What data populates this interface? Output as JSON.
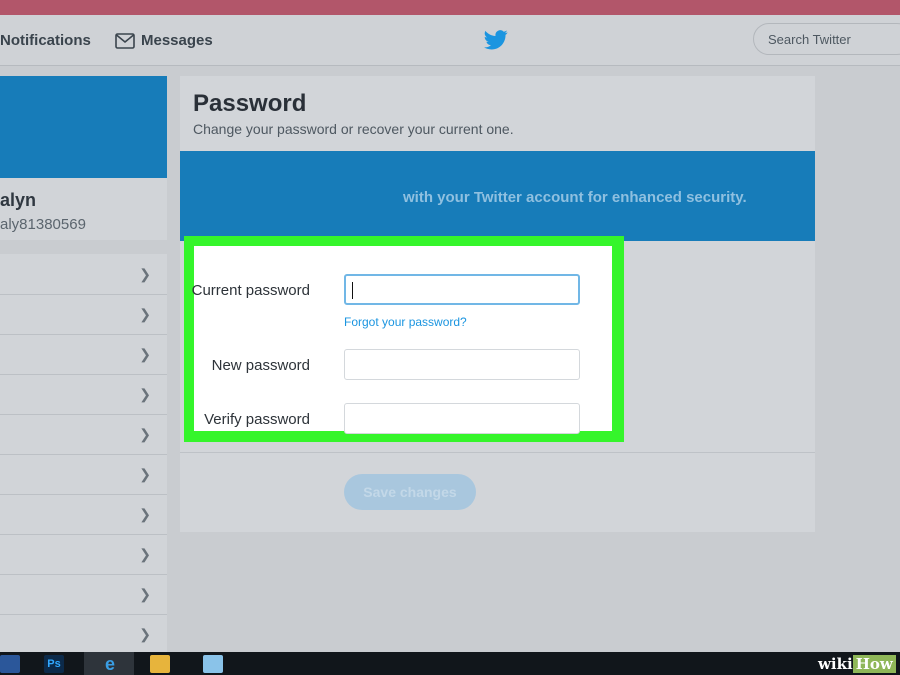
{
  "nav": {
    "notifications_label": "Notifications",
    "messages_label": "Messages",
    "search_placeholder": "Search Twitter"
  },
  "profile": {
    "name": "alyn",
    "handle": "aly81380569"
  },
  "sidebar": {
    "rows": 10
  },
  "panel": {
    "title": "Password",
    "subtitle": "Change your password or recover your current one.",
    "banner_text": "with your Twitter account for enhanced security.",
    "save_label": "Save changes"
  },
  "form": {
    "current_label": "Current password",
    "current_value": "",
    "forgot_link": "Forgot your password?",
    "new_label": "New password",
    "new_value": "",
    "verify_label": "Verify password",
    "verify_value": ""
  },
  "taskbar": {
    "ps_label": "Ps"
  },
  "watermark": {
    "wiki": "wiki",
    "how": "How"
  },
  "colors": {
    "accent": "#1b95e0",
    "highlight": "#35f52b",
    "banner": "#177cb9"
  }
}
